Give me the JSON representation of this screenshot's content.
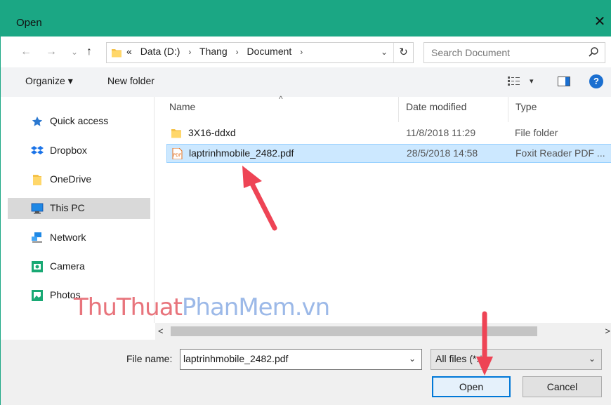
{
  "window": {
    "title": "Open",
    "close_glyph": "✕"
  },
  "nav": {
    "back": "←",
    "forward": "→",
    "recent": "⌄",
    "up": "↑"
  },
  "address": {
    "overflow": "«",
    "crumbs": [
      "Data (D:)",
      "Thang",
      "Document"
    ],
    "separator": "›",
    "dropdown": "⌄",
    "refresh": "↻"
  },
  "search": {
    "placeholder": "Search Document"
  },
  "toolbar": {
    "organize_label": "Organize ▾",
    "new_folder_label": "New folder",
    "view_caret": "▾",
    "help": "?"
  },
  "sidebar": {
    "items": [
      {
        "label": "Quick access",
        "icon": "star-icon"
      },
      {
        "label": "Dropbox",
        "icon": "dropbox-icon"
      },
      {
        "label": "OneDrive",
        "icon": "onedrive-folder-icon"
      },
      {
        "label": "This PC",
        "icon": "computer-icon",
        "selected": true
      },
      {
        "label": "Network",
        "icon": "network-icon"
      },
      {
        "label": "Camera",
        "icon": "camera-icon"
      },
      {
        "label": "Photos",
        "icon": "photos-icon"
      }
    ]
  },
  "columns": {
    "name": "Name",
    "date": "Date modified",
    "type": "Type",
    "sort_glyph": "^"
  },
  "files": [
    {
      "name": "3X16-ddxd",
      "date": "11/8/2018 11:29",
      "type": "File folder",
      "icon": "folder-icon"
    },
    {
      "name": "laptrinhmobile_2482.pdf",
      "date": "28/5/2018 14:58",
      "type": "Foxit Reader PDF ...",
      "icon": "pdf-file-icon",
      "selected": true
    }
  ],
  "scrollbar": {
    "left": "<",
    "right": ">"
  },
  "watermark": {
    "part1": "ThuThuat",
    "part2": "PhanMem.vn"
  },
  "bottom": {
    "filename_label": "File name:",
    "filename_value": "laptrinhmobile_2482.pdf",
    "filter_value": "All files (*.*)",
    "dropdown": "⌄",
    "open_label": "Open",
    "cancel_label": "Cancel"
  },
  "colors": {
    "titlebar": "#1ba784",
    "selection": "#cce8ff",
    "arrow": "#ee4455",
    "accent": "#0078d7"
  }
}
